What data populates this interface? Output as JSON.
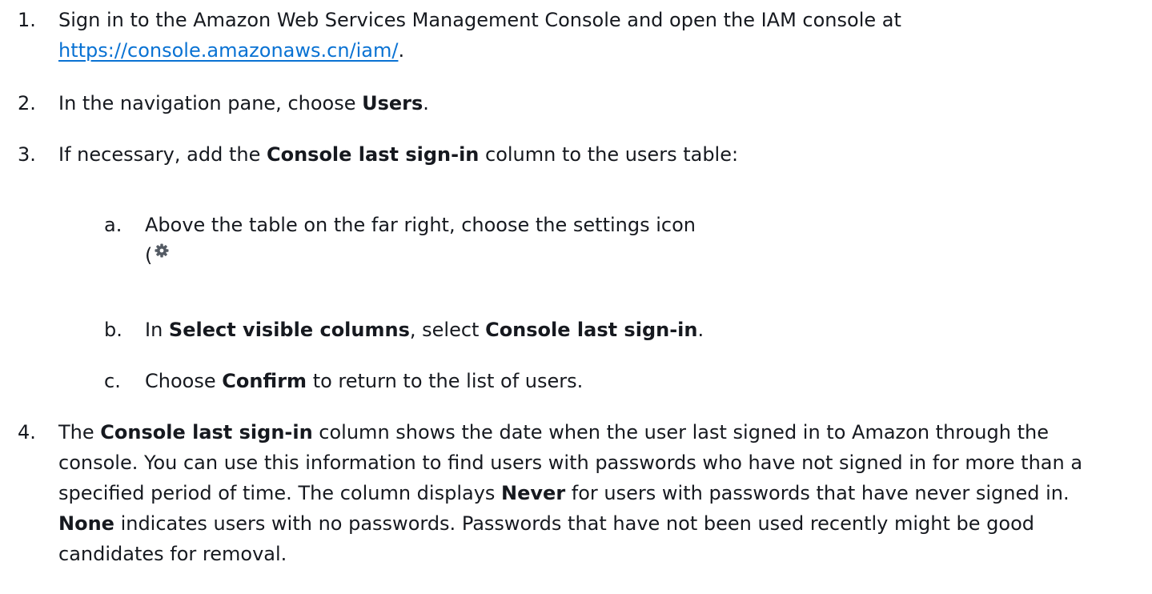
{
  "steps": [
    {
      "num": "1.",
      "text_before_link": "Sign in to the Amazon Web Services Management Console and open the IAM console at",
      "link": "https://console.amazonaws.cn/iam/",
      "text_after_link": "."
    },
    {
      "num": "2.",
      "text_before": "In the navigation pane, choose ",
      "bold": "Users",
      "text_after": "."
    },
    {
      "num": "3.",
      "text_before": "If necessary, add the ",
      "bold": "Console last sign-in",
      "text_after": " column to the users table:",
      "substeps": [
        {
          "num": "a.",
          "text": "Above the table on the far right, choose the settings icon",
          "paren": "(",
          "icon": "gear-icon"
        },
        {
          "num": "b.",
          "text_before": "In ",
          "bold1": "Select visible columns",
          "text_middle": ", select ",
          "bold2": "Console last sign-in",
          "text_after": "."
        },
        {
          "num": "c.",
          "text_before": "Choose ",
          "bold": "Confirm",
          "text_after": " to return to the list of users."
        }
      ]
    },
    {
      "num": "4.",
      "text_1": "The ",
      "bold_1": "Console last sign-in",
      "text_2": " column shows the date when the user last signed in to Amazon through the console. You can use this information to find users with passwords who have not signed in for more than a specified period of time. The column displays ",
      "bold_2": "Never",
      "text_3": " for users with passwords that have never signed in. ",
      "bold_3": "None",
      "text_4": " indicates users with no passwords. Passwords that have not been used recently might be good candidates for removal."
    }
  ],
  "colors": {
    "text": "#16191f",
    "link": "#0972d3",
    "icon": "#545b64"
  }
}
